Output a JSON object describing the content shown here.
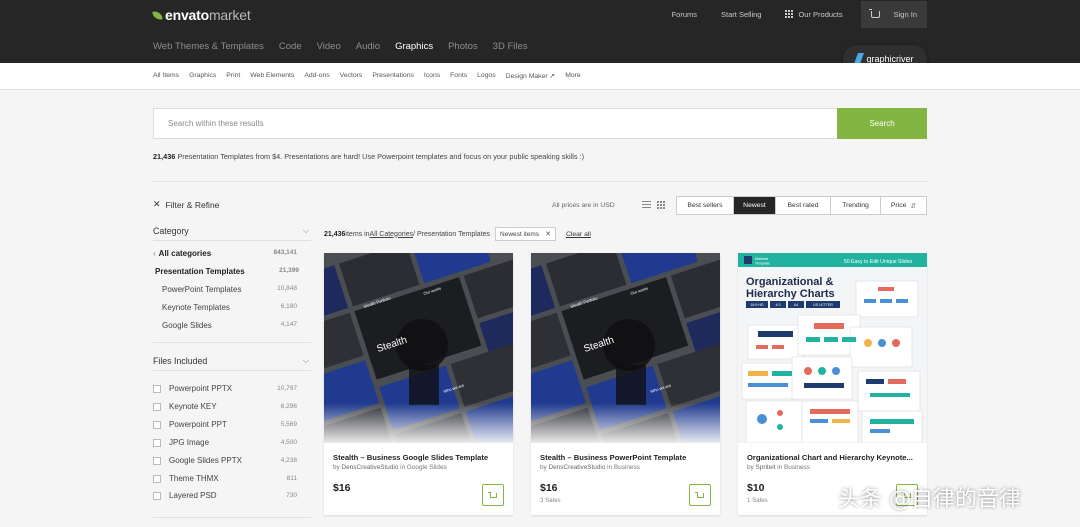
{
  "header": {
    "logo_brand": "envato",
    "logo_suffix": "market",
    "links": {
      "forums": "Forums",
      "start_selling": "Start Selling",
      "our_products": "Our Products",
      "sign_in": "Sign In"
    },
    "categories": [
      "Web Themes & Templates",
      "Code",
      "Video",
      "Audio",
      "Graphics",
      "Photos",
      "3D Files"
    ],
    "active_category": "Graphics",
    "site_badge": "graphicriver"
  },
  "subnav": [
    "All Items",
    "Graphics",
    "Print",
    "Web Elements",
    "Add-ons",
    "Vectors",
    "Presentations",
    "Icons",
    "Fonts",
    "Logos",
    "Design Maker ↗",
    "More"
  ],
  "search": {
    "placeholder": "Search within these results",
    "button": "Search"
  },
  "summary": {
    "count": "21,436",
    "text": " Presentation Templates from $4.  Presentations are hard! Use Powerpoint templates and focus on your public speaking skills :)"
  },
  "sidebar": {
    "filter_title": "Filter & Refine",
    "category": {
      "title": "Category",
      "items": [
        {
          "label": "All categories",
          "count": "843,141"
        },
        {
          "label": "Presentation Templates",
          "count": "21,399"
        },
        {
          "label": "PowerPoint Templates",
          "count": "10,848"
        },
        {
          "label": "Keynote Templates",
          "count": "6,180"
        },
        {
          "label": "Google Slides",
          "count": "4,147"
        }
      ]
    },
    "files": {
      "title": "Files Included",
      "items": [
        {
          "label": "Powerpoint PPTX",
          "count": "10,797"
        },
        {
          "label": "Keynote KEY",
          "count": "6,296"
        },
        {
          "label": "Powerpoint PPT",
          "count": "5,569"
        },
        {
          "label": "JPG Image",
          "count": "4,500"
        },
        {
          "label": "Google Slides PPTX",
          "count": "4,238"
        },
        {
          "label": "Theme THMX",
          "count": "811"
        },
        {
          "label": "Layered PSD",
          "count": "730"
        }
      ]
    }
  },
  "toolbar": {
    "prices_note": "All prices are in USD",
    "sort": [
      "Best sellers",
      "Newest",
      "Best rated",
      "Trending",
      "Price"
    ],
    "active_sort": "Newest"
  },
  "results": {
    "count": "21,436",
    "items_in": " items in ",
    "crumb_root": "All Categories",
    "crumb_leaf": " / Presentation Templates",
    "chip": "Newest items",
    "clear": "Clear all"
  },
  "cards": [
    {
      "title": "Stealth – Business Google Slides Template",
      "author": "DensCreativeStudio",
      "category": "Google Slides",
      "price": "$16",
      "sales": ""
    },
    {
      "title": "Stealth – Business PowerPoint Template",
      "author": "DensCreativeStudio",
      "category": "Business",
      "price": "$16",
      "sales": "3 Sales"
    },
    {
      "title": "Organizational Chart and Hierarchy Keynote...",
      "author": "Spriteit",
      "category": "Business",
      "price": "$10",
      "sales": "1 Sales"
    }
  ],
  "card_art": {
    "stealth": {
      "hero": "Stealth",
      "tag1": "Our works",
      "tag2": "Stealth Portfolio",
      "tag3": "Who we are"
    },
    "org": {
      "banner": "50 Easy to Edit Unique Slides",
      "brand_line1": "Marketa",
      "brand_line2": "Template",
      "heading_line1": "Organizational &",
      "heading_line2": "Hierarchy Charts",
      "pills": [
        "16:9 HD",
        "4:3",
        "A4",
        "US LETTER"
      ]
    }
  },
  "watermark": "头条 @自律的音律",
  "colors": {
    "accent": "#82b541",
    "header_bg": "#262626",
    "navy": "#1f3a8f",
    "teal": "#21b3a0"
  }
}
